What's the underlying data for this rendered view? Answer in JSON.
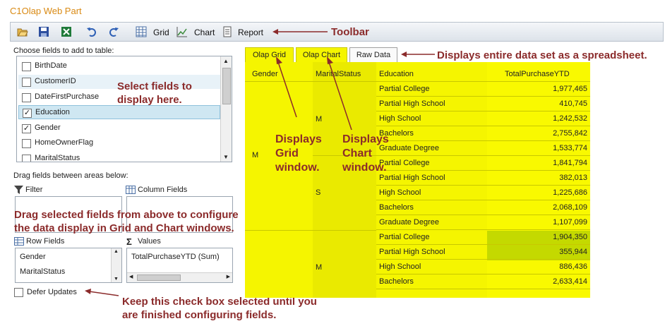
{
  "app_title": "C1Olap Web Part",
  "toolbar": {
    "grid_label": "Grid",
    "chart_label": "Chart",
    "report_label": "Report"
  },
  "fields_panel": {
    "heading": "Choose fields to add to table:",
    "items": [
      {
        "label": "BirthDate",
        "checked": false
      },
      {
        "label": "CustomerID",
        "checked": false
      },
      {
        "label": "DateFirstPurchase",
        "checked": false
      },
      {
        "label": "Education",
        "checked": true
      },
      {
        "label": "Gender",
        "checked": true
      },
      {
        "label": "HomeOwnerFlag",
        "checked": false
      },
      {
        "label": "MaritalStatus",
        "checked": false
      }
    ],
    "drag_heading": "Drag fields between areas below:",
    "filter_label": "Filter",
    "column_fields_label": "Column Fields",
    "row_fields_label": "Row Fields",
    "values_label": "Values",
    "row_fields": [
      "Gender",
      "MaritalStatus"
    ],
    "values": [
      "TotalPurchaseYTD (Sum)"
    ],
    "defer_label": "Defer Updates"
  },
  "tabs": [
    "Olap Grid",
    "Olap Chart",
    "Raw Data"
  ],
  "grid": {
    "headers": [
      "Gender",
      "MaritalStatus",
      "Education",
      "TotalPurchaseYTD"
    ],
    "gender_values": [
      "M",
      "M"
    ],
    "marital_values": [
      "M",
      "S",
      "M"
    ],
    "rows": [
      {
        "education": "Partial College",
        "total": "1,977,465"
      },
      {
        "education": "Partial High School",
        "total": "410,745"
      },
      {
        "education": "High School",
        "total": "1,242,532"
      },
      {
        "education": "Bachelors",
        "total": "2,755,842"
      },
      {
        "education": "Graduate Degree",
        "total": "1,533,774"
      },
      {
        "education": "Partial College",
        "total": "1,841,794"
      },
      {
        "education": "Partial High School",
        "total": "382,013"
      },
      {
        "education": "High School",
        "total": "1,225,686"
      },
      {
        "education": "Bachelors",
        "total": "2,068,109"
      },
      {
        "education": "Graduate Degree",
        "total": "1,107,099"
      },
      {
        "education": "Partial College",
        "total": "1,904,350"
      },
      {
        "education": "Partial High School",
        "total": "355,944"
      },
      {
        "education": "High School",
        "total": "886,436"
      },
      {
        "education": "Bachelors",
        "total": "2,633,414"
      }
    ]
  },
  "annotations": {
    "toolbar": "Toolbar",
    "raw_data": "Displays entire data set as a spreadsheet.",
    "select_fields_1": "Select fields to",
    "select_fields_2": "display here.",
    "grid_window_1": "Displays",
    "grid_window_2": "Grid",
    "grid_window_3": "window.",
    "chart_window_1": "Displays",
    "chart_window_2": "Chart",
    "chart_window_3": "window.",
    "drag_1": "Drag selected fields from above to configure",
    "drag_2": "the data display in Grid and Chart windows.",
    "defer_1": "Keep this check box selected until you",
    "defer_2": "are finished configuring fields."
  },
  "colors": {
    "highlight": "#f5f500",
    "annotation_text": "#8b2b2b",
    "title": "#d98a14",
    "selected_row": "#cfe7f2"
  }
}
